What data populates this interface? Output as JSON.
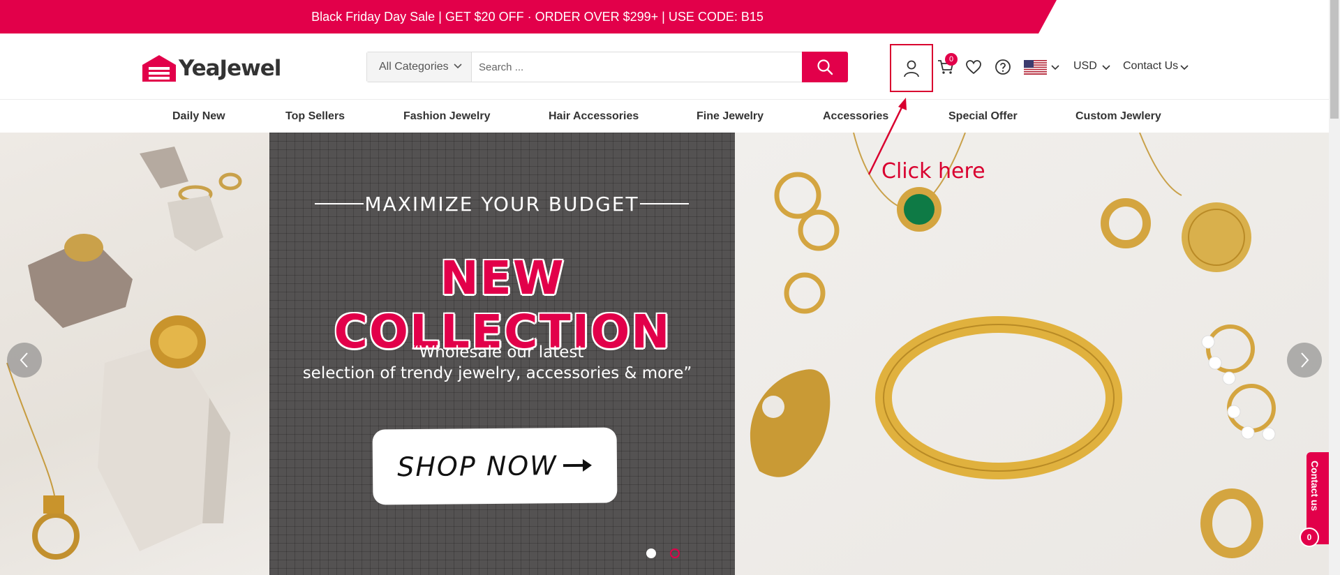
{
  "promo": {
    "text": "Black Friday Day Sale | GET $20 OFF · ORDER OVER $299+ | USE CODE: B15"
  },
  "brand": {
    "name": "YeaJewel",
    "accent": "#e2004a"
  },
  "search": {
    "category": "All Categories",
    "placeholder": "Search ...",
    "icon": "search-icon"
  },
  "header_icons": {
    "account": "user-icon",
    "cart": "cart-icon",
    "cart_count": "0",
    "wishlist": "heart-icon",
    "help": "help-icon",
    "flag": "us-flag-icon"
  },
  "currency": "USD",
  "contact": "Contact Us",
  "nav": [
    "Daily New",
    "Top Sellers",
    "Fashion Jewelry",
    "Hair Accessories",
    "Fine Jewelry",
    "Accessories",
    "Special Offer",
    "Custom Jewlery"
  ],
  "hero": {
    "kicker": "MAXIMIZE YOUR BUDGET",
    "headline": "NEW COLLECTION",
    "quote_line1": "“Wholesale our latest",
    "quote_line2": "selection of trendy jewelry, accessories & more”",
    "cta": "SHOP NOW",
    "slide_count": 2,
    "active_slide": 1
  },
  "floating_contact": {
    "label": "Contact us",
    "count": "0"
  },
  "annotation": {
    "label": "Click here"
  }
}
